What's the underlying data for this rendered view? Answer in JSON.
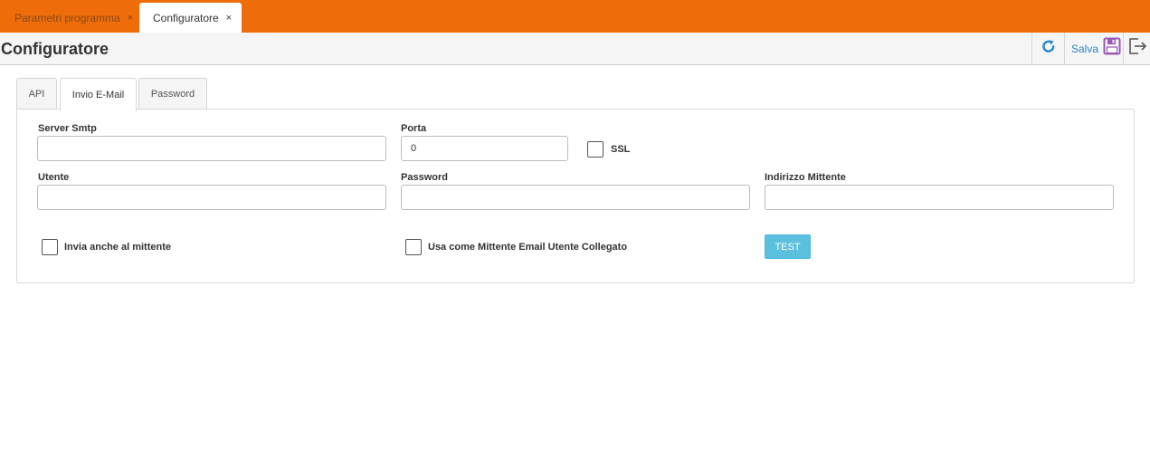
{
  "top_tabs": [
    {
      "label": "Parametri programma",
      "close": "×"
    },
    {
      "label": "Configuratore",
      "close": "×"
    }
  ],
  "header": {
    "title": "Configuratore",
    "save_label": "Salva",
    "icons": [
      "refresh-icon",
      "save-disk-icon",
      "exit-icon"
    ]
  },
  "tabs": [
    {
      "label": "API"
    },
    {
      "label": "Invio E-Mail",
      "active": true
    },
    {
      "label": "Password"
    }
  ],
  "form": {
    "server_smtp": {
      "label": "Server Smtp",
      "value": ""
    },
    "porta": {
      "label": "Porta",
      "value": "0"
    },
    "ssl": {
      "label": "SSL",
      "checked": false
    },
    "utente": {
      "label": "Utente",
      "value": ""
    },
    "password": {
      "label": "Password",
      "value": ""
    },
    "indirizzo_mittente": {
      "label": "Indirizzo Mittente",
      "value": ""
    },
    "invia_mittente": {
      "label": "Invia anche al mittente",
      "checked": false
    },
    "usa_mittente": {
      "label": "Usa come Mittente Email Utente Collegato",
      "checked": false
    },
    "test_label": "TEST"
  },
  "colors": {
    "topbar": "#ee6c0a",
    "accent": "#2a86c9",
    "test_button": "#5bc0de",
    "save_icon": "#9b59b6"
  }
}
